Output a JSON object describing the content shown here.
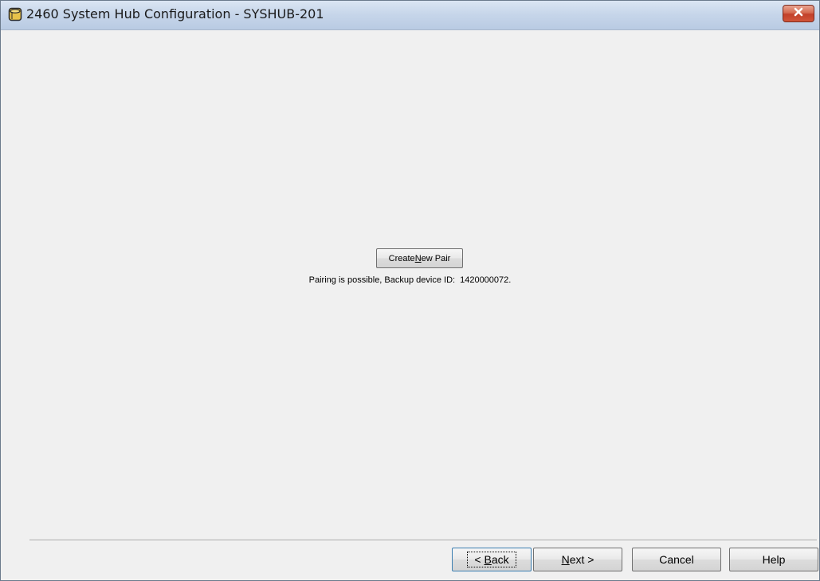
{
  "window": {
    "title": "2460 System Hub Configuration - SYSHUB-201",
    "icon": "database-icon",
    "close_icon": "close-icon"
  },
  "main": {
    "create_pair_button": {
      "prefix": "Create ",
      "mnemonic": "N",
      "suffix": "ew Pair"
    },
    "status": {
      "message": "Pairing is possible, Backup device ID:",
      "device_id": "1420000072."
    }
  },
  "footer": {
    "back": {
      "prefix": "< ",
      "mnemonic": "B",
      "suffix": "ack"
    },
    "next": {
      "mnemonic": "N",
      "suffix": "ext >"
    },
    "cancel": "Cancel",
    "help": "Help"
  },
  "colors": {
    "titlebar": "#c7d6ea",
    "close_button": "#c2402a",
    "background": "#f0f0f0"
  }
}
